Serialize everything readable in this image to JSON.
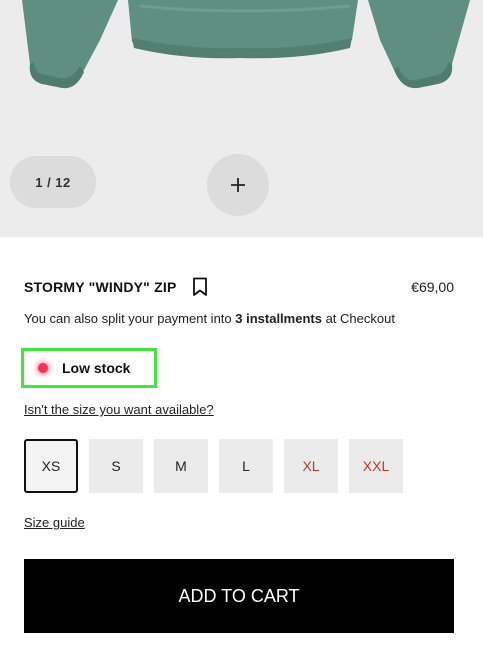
{
  "gallery": {
    "counter": "1 / 12",
    "zoom_icon": "plus-icon",
    "image_subject": "green sweatshirt"
  },
  "product": {
    "name": "STORMY \"WINDY\" ZIP",
    "price": "€69,00",
    "bookmark_icon": "bookmark-icon",
    "installments_prefix": "You can also split your payment into ",
    "installments_bold": "3 installments",
    "installments_suffix": " at Checkout"
  },
  "stock": {
    "label": "Low stock",
    "indicator_color": "#ff2d55",
    "highlight_color": "#3ee83a"
  },
  "size_link": "Isn't the size you want available?",
  "sizes": [
    {
      "label": "XS",
      "selected": true,
      "available": true
    },
    {
      "label": "S",
      "selected": false,
      "available": true
    },
    {
      "label": "M",
      "selected": false,
      "available": true
    },
    {
      "label": "L",
      "selected": false,
      "available": true
    },
    {
      "label": "XL",
      "selected": false,
      "available": false
    },
    {
      "label": "XXL",
      "selected": false,
      "available": false
    }
  ],
  "size_guide": "Size guide",
  "add_to_cart": "ADD TO CART",
  "colors": {
    "garment": "#5e8f80",
    "unavailable_size": "#c0392b",
    "cart_button": "#000000"
  }
}
